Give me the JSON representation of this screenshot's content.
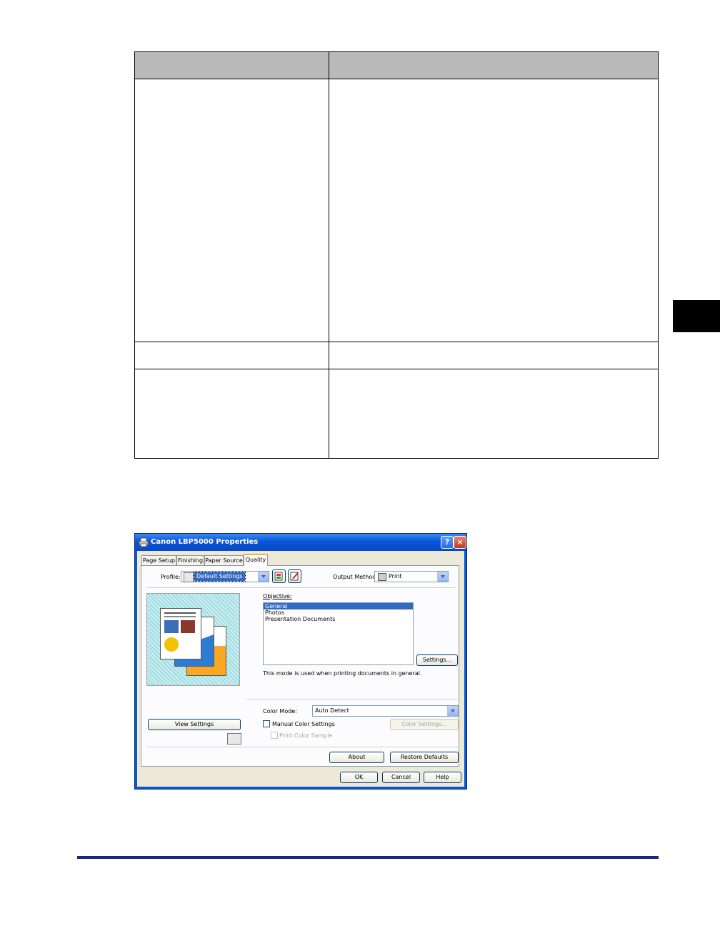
{
  "dialog": {
    "title": "Canon LBP5000 Properties",
    "tabs": [
      {
        "label": "Page Setup"
      },
      {
        "label": "Finishing"
      },
      {
        "label": "Paper Source"
      },
      {
        "label": "Quality"
      }
    ],
    "profile": {
      "label": "Profile:",
      "value": "Default Settings"
    },
    "output_method": {
      "label": "Output Method:",
      "value": "Print"
    },
    "objective": {
      "label": "Objective:",
      "items": [
        "General",
        "Photos",
        "Presentation Documents"
      ],
      "selected": "General"
    },
    "settings_button": "Settings...",
    "description": "This mode is used when printing documents in general.",
    "color_mode": {
      "label": "Color Mode:",
      "value": "Auto Detect"
    },
    "manual_color_settings": "Manual Color Settings",
    "color_settings_button": "Color Settings...",
    "print_color_sample": "Print Color Sample",
    "view_settings_button": "View Settings",
    "about_button": "About",
    "restore_defaults_button": "Restore Defaults",
    "ok_button": "OK",
    "cancel_button": "Cancel",
    "help_button": "Help"
  },
  "colors": {
    "title_bar": "#0a56d8",
    "selection": "#316ac5",
    "table_header": "#b9b9b9",
    "footer_rule": "#1a237e"
  }
}
